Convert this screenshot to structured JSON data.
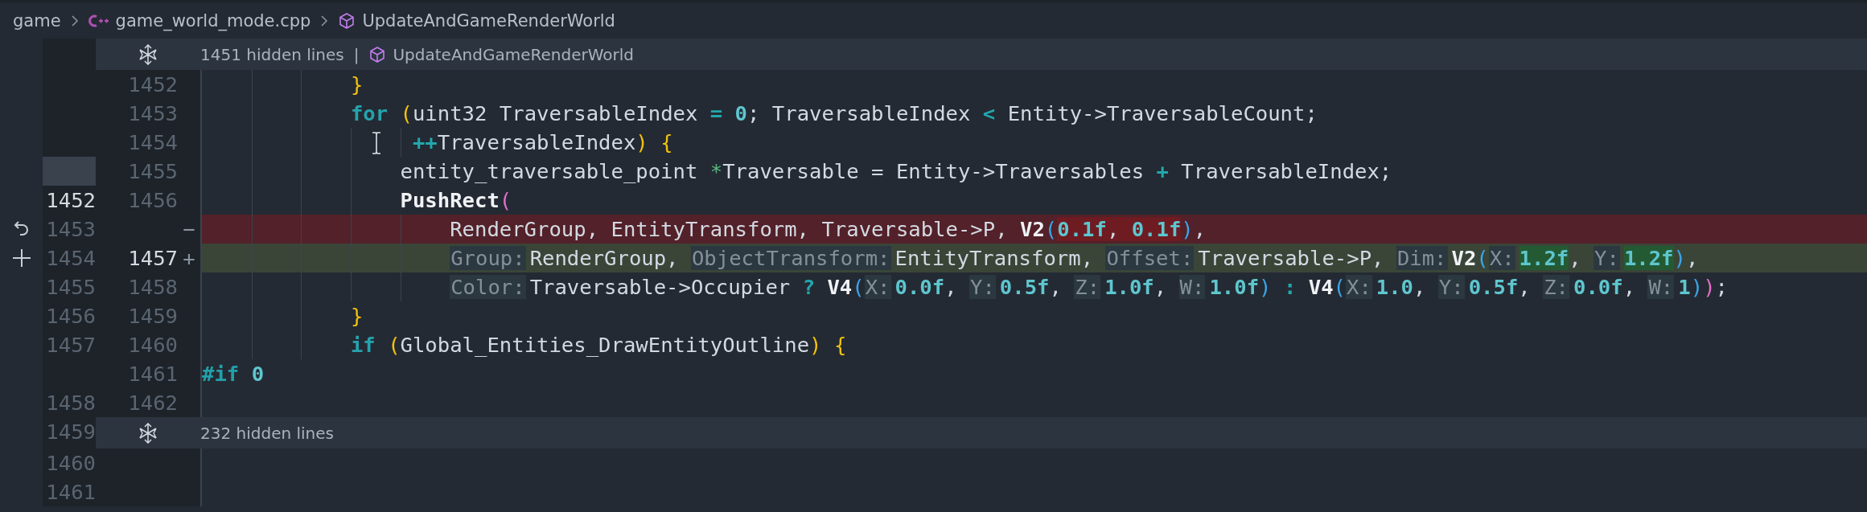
{
  "breadcrumb": {
    "items": [
      {
        "kind": "folder",
        "label": "game"
      },
      {
        "kind": "file",
        "label": "game_world_mode.cpp"
      },
      {
        "kind": "symbol",
        "label": "UpdateAndGameRenderWorld"
      }
    ]
  },
  "rows": [
    {
      "kind": "fold",
      "old": {
        "filler": false
      },
      "label": "1451 hidden lines",
      "separator": "|",
      "symbol": "UpdateAndGameRenderWorld"
    },
    {
      "kind": "line",
      "old": {
        "filler": false
      },
      "new": {
        "number": "1452",
        "current": false
      },
      "tokens": [
        {
          "kind": "brace",
          "text": "            }"
        }
      ]
    },
    {
      "kind": "line",
      "old": {
        "filler": false
      },
      "new": {
        "number": "1453",
        "current": false
      },
      "tokens": [
        {
          "kind": "kw",
          "text": "            for"
        },
        {
          "kind": "brace",
          "text": " ("
        },
        {
          "kind": "plain",
          "text": "uint32 TraversableIndex "
        },
        {
          "kind": "op",
          "text": "="
        },
        {
          "kind": "num",
          "text": " 0"
        },
        {
          "kind": "plain",
          "text": "; TraversableIndex "
        },
        {
          "kind": "op",
          "text": "<"
        },
        {
          "kind": "plain",
          "text": " Entity->TraversableCount;"
        }
      ]
    },
    {
      "kind": "line",
      "old": {
        "filler": false
      },
      "new": {
        "number": "1454",
        "current": false
      },
      "cursor": true,
      "tokens": [
        {
          "kind": "op",
          "text": "                 ++"
        },
        {
          "kind": "plain",
          "text": "TraversableIndex"
        },
        {
          "kind": "brace",
          "text": ")"
        },
        {
          "kind": "brace",
          "text": " {"
        }
      ]
    },
    {
      "kind": "line",
      "old": {
        "filler": true
      },
      "new": {
        "number": "1455",
        "current": false
      },
      "tokens": [
        {
          "kind": "plain",
          "text": "                entity_traversable_point "
        },
        {
          "kind": "ptr",
          "text": "*"
        },
        {
          "kind": "plain",
          "text": "Traversable = Entity->Traversables "
        },
        {
          "kind": "op",
          "text": "+"
        },
        {
          "kind": "plain",
          "text": " TraversableIndex;"
        }
      ]
    },
    {
      "kind": "line",
      "old": {
        "number": "1452",
        "filler": false,
        "current": true
      },
      "new": {
        "number": "1456",
        "current": false
      },
      "tokens": [
        {
          "kind": "fn",
          "text": "                PushRect"
        },
        {
          "kind": "paren",
          "text": "("
        }
      ]
    },
    {
      "kind": "removed",
      "old": {
        "number": "1453",
        "filler": false,
        "current": false
      },
      "marker": "−",
      "tokens": [
        {
          "kind": "plain",
          "text": "                    RenderGroup, EntityTransform, Traversable->P, ",
          "changed": false
        },
        {
          "kind": "fn",
          "text": "V2",
          "changed": false
        },
        {
          "kind": "bparen",
          "text": "(",
          "changed": false
        },
        {
          "kind": "num",
          "text": "0.1f",
          "changed": true
        },
        {
          "kind": "plain",
          "text": ", ",
          "changed": true
        },
        {
          "kind": "num",
          "text": "0.1f",
          "changed": true
        },
        {
          "kind": "bparen",
          "text": ")",
          "changed": false
        },
        {
          "kind": "plain",
          "text": ",",
          "changed": false
        }
      ]
    },
    {
      "kind": "added",
      "old": {
        "number": "1454",
        "filler": false,
        "current": false
      },
      "new": {
        "number": "1457",
        "current": true
      },
      "marker": "+",
      "tokens": [
        {
          "kind": "hint",
          "text": "                    Group:"
        },
        {
          "kind": "plain",
          "text": "RenderGroup, ",
          "changed": false
        },
        {
          "kind": "hint",
          "text": "ObjectTransform:"
        },
        {
          "kind": "plain",
          "text": "EntityTransform, ",
          "changed": false
        },
        {
          "kind": "hint",
          "text": "Offset:"
        },
        {
          "kind": "plain",
          "text": "Traversable->P, ",
          "changed": false
        },
        {
          "kind": "hint",
          "text": "Dim:"
        },
        {
          "kind": "fn",
          "text": "V2",
          "changed": false
        },
        {
          "kind": "bparen",
          "text": "(",
          "changed": false
        },
        {
          "kind": "hint",
          "text": "X:"
        },
        {
          "kind": "num",
          "text": "1.2f",
          "changed": true
        },
        {
          "kind": "plain",
          "text": ", ",
          "changed": false
        },
        {
          "kind": "hint",
          "text": "Y:"
        },
        {
          "kind": "num",
          "text": "1.2f",
          "changed": true
        },
        {
          "kind": "bparen",
          "text": ")",
          "changed": false
        },
        {
          "kind": "plain",
          "text": ",",
          "changed": false
        }
      ]
    },
    {
      "kind": "line",
      "old": {
        "number": "1455",
        "filler": false,
        "current": false
      },
      "new": {
        "number": "1458",
        "current": false
      },
      "tokens": [
        {
          "kind": "hint",
          "text": "                    Color:"
        },
        {
          "kind": "plain",
          "text": "Traversable->Occupier "
        },
        {
          "kind": "op",
          "text": "?"
        },
        {
          "kind": "fn",
          "text": " V4"
        },
        {
          "kind": "bparen",
          "text": "("
        },
        {
          "kind": "hint",
          "text": "X:"
        },
        {
          "kind": "num",
          "text": "0.0f"
        },
        {
          "kind": "plain",
          "text": ", "
        },
        {
          "kind": "hint",
          "text": "Y:"
        },
        {
          "kind": "num",
          "text": "0.5f"
        },
        {
          "kind": "plain",
          "text": ", "
        },
        {
          "kind": "hint",
          "text": "Z:"
        },
        {
          "kind": "num",
          "text": "1.0f"
        },
        {
          "kind": "plain",
          "text": ", "
        },
        {
          "kind": "hint",
          "text": "W:"
        },
        {
          "kind": "num",
          "text": "1.0f"
        },
        {
          "kind": "bparen",
          "text": ")"
        },
        {
          "kind": "op",
          "text": " :"
        },
        {
          "kind": "fn",
          "text": " V4"
        },
        {
          "kind": "bparen",
          "text": "("
        },
        {
          "kind": "hint",
          "text": "X:"
        },
        {
          "kind": "num",
          "text": "1.0"
        },
        {
          "kind": "plain",
          "text": ", "
        },
        {
          "kind": "hint",
          "text": "Y:"
        },
        {
          "kind": "num",
          "text": "0.5f"
        },
        {
          "kind": "plain",
          "text": ", "
        },
        {
          "kind": "hint",
          "text": "Z:"
        },
        {
          "kind": "num",
          "text": "0.0f"
        },
        {
          "kind": "plain",
          "text": ", "
        },
        {
          "kind": "hint",
          "text": "W:"
        },
        {
          "kind": "num",
          "text": "1"
        },
        {
          "kind": "bparen",
          "text": ")"
        },
        {
          "kind": "paren",
          "text": ")"
        },
        {
          "kind": "plain",
          "text": ";"
        }
      ]
    },
    {
      "kind": "line",
      "old": {
        "number": "1456",
        "filler": false,
        "current": false
      },
      "new": {
        "number": "1459",
        "current": false
      },
      "tokens": [
        {
          "kind": "brace",
          "text": "            }"
        }
      ]
    },
    {
      "kind": "line",
      "old": {
        "number": "1457",
        "filler": false,
        "current": false
      },
      "new": {
        "number": "1460",
        "current": false
      },
      "tokens": [
        {
          "kind": "kw",
          "text": "            if"
        },
        {
          "kind": "brace",
          "text": " ("
        },
        {
          "kind": "plain",
          "text": "Global_Entities_DrawEntityOutline"
        },
        {
          "kind": "brace",
          "text": ")"
        },
        {
          "kind": "brace",
          "text": " {"
        }
      ]
    },
    {
      "kind": "line",
      "old": {
        "filler": false
      },
      "new": {
        "number": "1461",
        "current": false
      },
      "tokens": [
        {
          "kind": "pp",
          "text": "#if"
        },
        {
          "kind": "num",
          "text": " 0"
        }
      ]
    },
    {
      "kind": "line",
      "old": {
        "number": "1458",
        "filler": false,
        "current": false
      },
      "new": {
        "number": "1462",
        "current": false
      },
      "tokens": []
    },
    {
      "kind": "fold",
      "old": {
        "number": "1459",
        "filler": false,
        "current": false
      },
      "label": "232 hidden lines"
    },
    {
      "kind": "line",
      "old": {
        "number": "1460",
        "filler": false,
        "current": false
      },
      "tokens": []
    },
    {
      "kind": "line",
      "old": {
        "number": "1461",
        "filler": false,
        "current": false
      },
      "tokens": []
    }
  ]
}
